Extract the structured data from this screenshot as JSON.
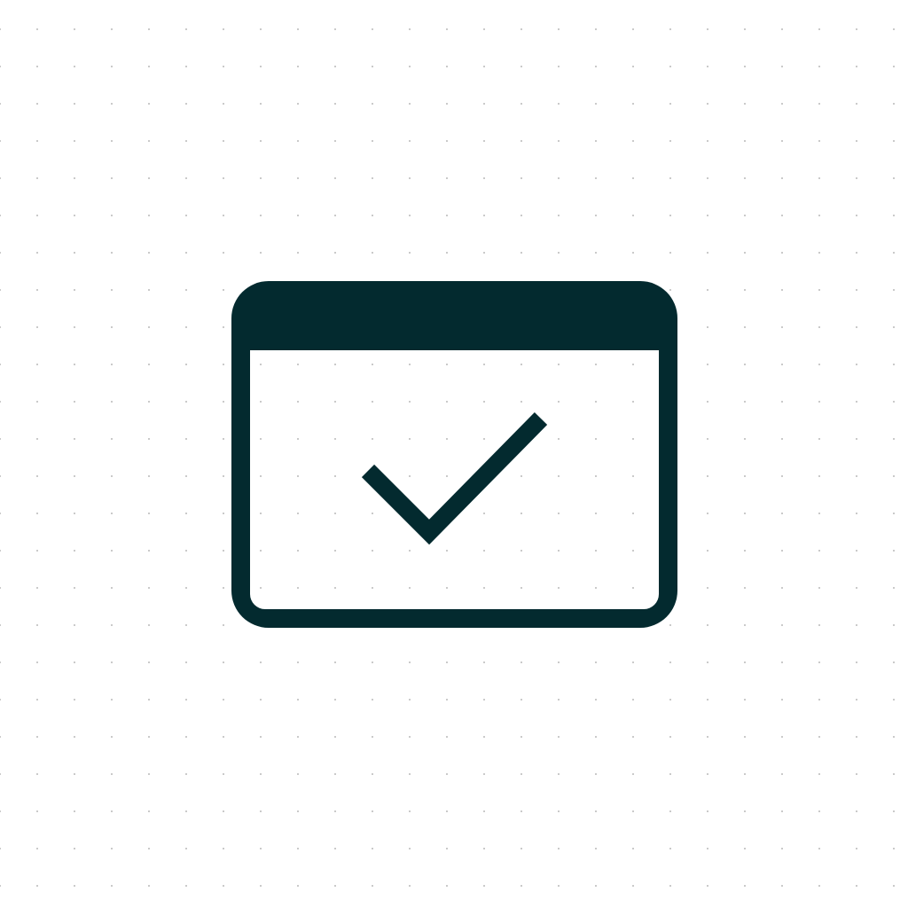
{
  "icon": {
    "name": "window-check-icon",
    "color": "#032a2f",
    "background": "#ffffff",
    "grid_dot_color": "#9a9a9a"
  }
}
